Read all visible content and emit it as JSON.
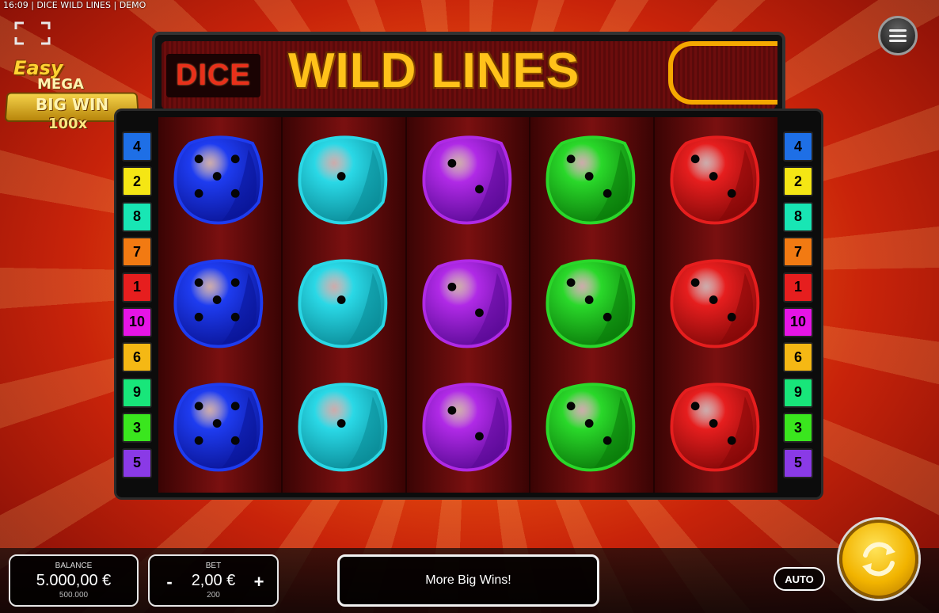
{
  "status_line": "16:09 | DICE WILD LINES | DEMO",
  "badge": {
    "easy": "Easy",
    "mega": "MEGA",
    "big_win": "BIG WIN",
    "multiplier": "100x"
  },
  "logo": {
    "dice": "DICE",
    "wild_lines": "WILD LINES"
  },
  "paylines": {
    "left": [
      "4",
      "2",
      "8",
      "7",
      "1",
      "10",
      "6",
      "9",
      "3",
      "5"
    ],
    "right": [
      "4",
      "2",
      "8",
      "7",
      "1",
      "10",
      "6",
      "9",
      "3",
      "5"
    ],
    "colors": {
      "4": "#1e6fe6",
      "2": "#f5e614",
      "8": "#18e6b4",
      "7": "#f27a12",
      "1": "#e61e1e",
      "10": "#e614e6",
      "6": "#f5b814",
      "9": "#18e67a",
      "3": "#3ae61e",
      "5": "#8a3ae6"
    }
  },
  "reels": [
    {
      "color": "blue",
      "hex": "#1e3cf0",
      "dark": "#0a1496",
      "symbols": [
        5,
        5,
        5
      ]
    },
    {
      "color": "cyan",
      "hex": "#2ad8e6",
      "dark": "#0a8a96",
      "symbols": [
        1,
        1,
        1
      ]
    },
    {
      "color": "purple",
      "hex": "#b02ae6",
      "dark": "#5a0a96",
      "symbols": [
        2,
        2,
        2
      ]
    },
    {
      "color": "green",
      "hex": "#2ad82a",
      "dark": "#0a7a0a",
      "symbols": [
        3,
        3,
        3
      ]
    },
    {
      "color": "red",
      "hex": "#e61e1e",
      "dark": "#820808",
      "symbols": [
        3,
        3,
        3
      ]
    }
  ],
  "balance": {
    "label": "BALANCE",
    "value": "5.000,00 €",
    "sub": "500.000"
  },
  "bet": {
    "label": "BET",
    "value": "2,00 €",
    "sub": "200",
    "minus": "-",
    "plus": "+"
  },
  "message": "More Big Wins!",
  "auto_label": "AUTO",
  "icons": {
    "fullscreen": "fullscreen-icon",
    "menu": "menu-icon",
    "spin": "spin-icon"
  }
}
